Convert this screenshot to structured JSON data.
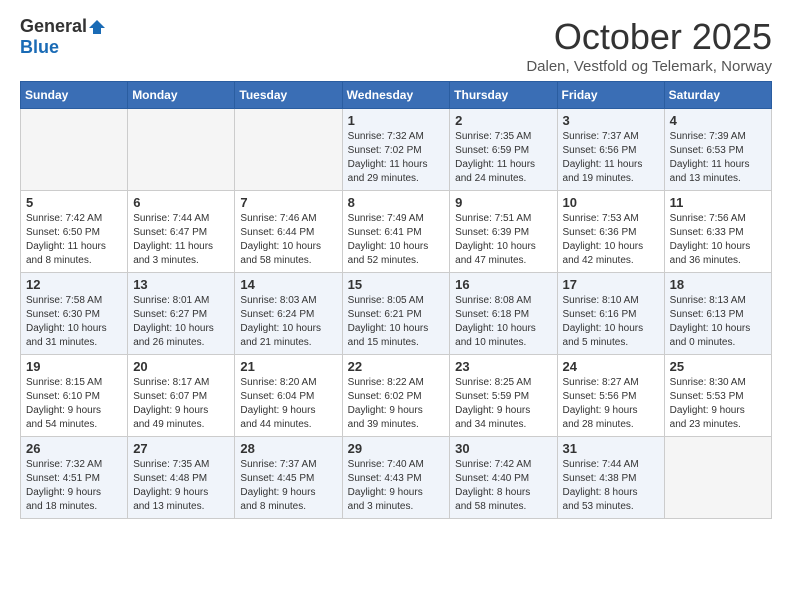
{
  "header": {
    "logo_general": "General",
    "logo_blue": "Blue",
    "month": "October 2025",
    "location": "Dalen, Vestfold og Telemark, Norway"
  },
  "days_of_week": [
    "Sunday",
    "Monday",
    "Tuesday",
    "Wednesday",
    "Thursday",
    "Friday",
    "Saturday"
  ],
  "weeks": [
    [
      {
        "date": "",
        "info": ""
      },
      {
        "date": "",
        "info": ""
      },
      {
        "date": "",
        "info": ""
      },
      {
        "date": "1",
        "info": "Sunrise: 7:32 AM\nSunset: 7:02 PM\nDaylight: 11 hours\nand 29 minutes."
      },
      {
        "date": "2",
        "info": "Sunrise: 7:35 AM\nSunset: 6:59 PM\nDaylight: 11 hours\nand 24 minutes."
      },
      {
        "date": "3",
        "info": "Sunrise: 7:37 AM\nSunset: 6:56 PM\nDaylight: 11 hours\nand 19 minutes."
      },
      {
        "date": "4",
        "info": "Sunrise: 7:39 AM\nSunset: 6:53 PM\nDaylight: 11 hours\nand 13 minutes."
      }
    ],
    [
      {
        "date": "5",
        "info": "Sunrise: 7:42 AM\nSunset: 6:50 PM\nDaylight: 11 hours\nand 8 minutes."
      },
      {
        "date": "6",
        "info": "Sunrise: 7:44 AM\nSunset: 6:47 PM\nDaylight: 11 hours\nand 3 minutes."
      },
      {
        "date": "7",
        "info": "Sunrise: 7:46 AM\nSunset: 6:44 PM\nDaylight: 10 hours\nand 58 minutes."
      },
      {
        "date": "8",
        "info": "Sunrise: 7:49 AM\nSunset: 6:41 PM\nDaylight: 10 hours\nand 52 minutes."
      },
      {
        "date": "9",
        "info": "Sunrise: 7:51 AM\nSunset: 6:39 PM\nDaylight: 10 hours\nand 47 minutes."
      },
      {
        "date": "10",
        "info": "Sunrise: 7:53 AM\nSunset: 6:36 PM\nDaylight: 10 hours\nand 42 minutes."
      },
      {
        "date": "11",
        "info": "Sunrise: 7:56 AM\nSunset: 6:33 PM\nDaylight: 10 hours\nand 36 minutes."
      }
    ],
    [
      {
        "date": "12",
        "info": "Sunrise: 7:58 AM\nSunset: 6:30 PM\nDaylight: 10 hours\nand 31 minutes."
      },
      {
        "date": "13",
        "info": "Sunrise: 8:01 AM\nSunset: 6:27 PM\nDaylight: 10 hours\nand 26 minutes."
      },
      {
        "date": "14",
        "info": "Sunrise: 8:03 AM\nSunset: 6:24 PM\nDaylight: 10 hours\nand 21 minutes."
      },
      {
        "date": "15",
        "info": "Sunrise: 8:05 AM\nSunset: 6:21 PM\nDaylight: 10 hours\nand 15 minutes."
      },
      {
        "date": "16",
        "info": "Sunrise: 8:08 AM\nSunset: 6:18 PM\nDaylight: 10 hours\nand 10 minutes."
      },
      {
        "date": "17",
        "info": "Sunrise: 8:10 AM\nSunset: 6:16 PM\nDaylight: 10 hours\nand 5 minutes."
      },
      {
        "date": "18",
        "info": "Sunrise: 8:13 AM\nSunset: 6:13 PM\nDaylight: 10 hours\nand 0 minutes."
      }
    ],
    [
      {
        "date": "19",
        "info": "Sunrise: 8:15 AM\nSunset: 6:10 PM\nDaylight: 9 hours\nand 54 minutes."
      },
      {
        "date": "20",
        "info": "Sunrise: 8:17 AM\nSunset: 6:07 PM\nDaylight: 9 hours\nand 49 minutes."
      },
      {
        "date": "21",
        "info": "Sunrise: 8:20 AM\nSunset: 6:04 PM\nDaylight: 9 hours\nand 44 minutes."
      },
      {
        "date": "22",
        "info": "Sunrise: 8:22 AM\nSunset: 6:02 PM\nDaylight: 9 hours\nand 39 minutes."
      },
      {
        "date": "23",
        "info": "Sunrise: 8:25 AM\nSunset: 5:59 PM\nDaylight: 9 hours\nand 34 minutes."
      },
      {
        "date": "24",
        "info": "Sunrise: 8:27 AM\nSunset: 5:56 PM\nDaylight: 9 hours\nand 28 minutes."
      },
      {
        "date": "25",
        "info": "Sunrise: 8:30 AM\nSunset: 5:53 PM\nDaylight: 9 hours\nand 23 minutes."
      }
    ],
    [
      {
        "date": "26",
        "info": "Sunrise: 7:32 AM\nSunset: 4:51 PM\nDaylight: 9 hours\nand 18 minutes."
      },
      {
        "date": "27",
        "info": "Sunrise: 7:35 AM\nSunset: 4:48 PM\nDaylight: 9 hours\nand 13 minutes."
      },
      {
        "date": "28",
        "info": "Sunrise: 7:37 AM\nSunset: 4:45 PM\nDaylight: 9 hours\nand 8 minutes."
      },
      {
        "date": "29",
        "info": "Sunrise: 7:40 AM\nSunset: 4:43 PM\nDaylight: 9 hours\nand 3 minutes."
      },
      {
        "date": "30",
        "info": "Sunrise: 7:42 AM\nSunset: 4:40 PM\nDaylight: 8 hours\nand 58 minutes."
      },
      {
        "date": "31",
        "info": "Sunrise: 7:44 AM\nSunset: 4:38 PM\nDaylight: 8 hours\nand 53 minutes."
      },
      {
        "date": "",
        "info": ""
      }
    ]
  ]
}
